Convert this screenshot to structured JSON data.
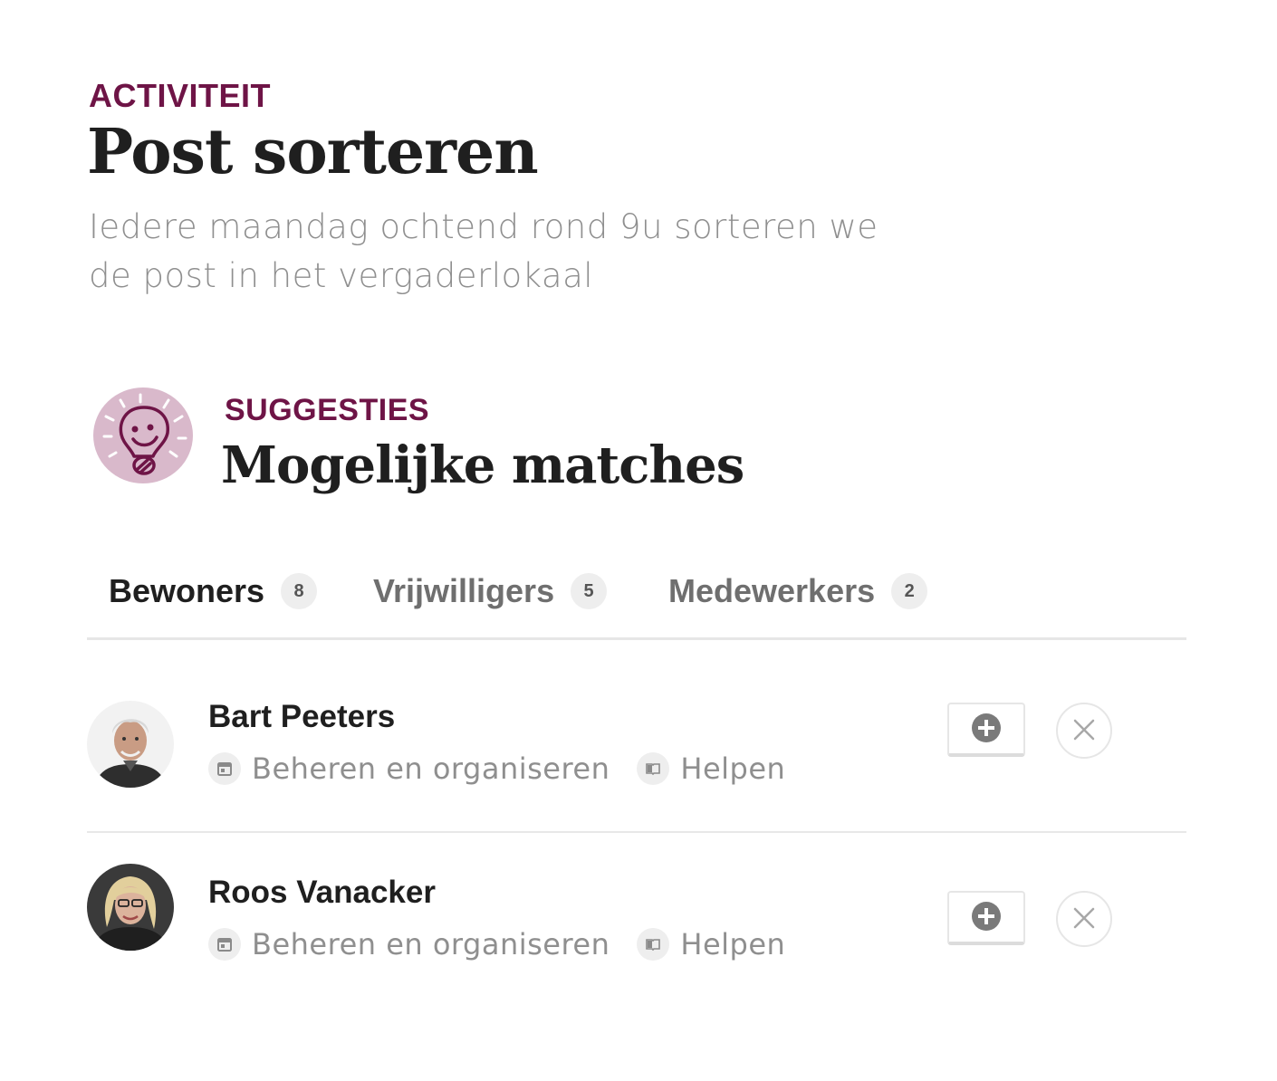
{
  "activity": {
    "eyebrow": "ACTIVITEIT",
    "title": "Post sorteren",
    "description": "Iedere maandag ochtend rond 9u sorteren we de post in het vergaderlokaal"
  },
  "suggestions": {
    "eyebrow": "SUGGESTIES",
    "title": "Mogelijke matches",
    "icon": "lightbulb-icon"
  },
  "tabs": [
    {
      "label": "Bewoners",
      "count": "8",
      "active": true
    },
    {
      "label": "Vrijwilligers",
      "count": "5",
      "active": false
    },
    {
      "label": "Medewerkers",
      "count": "2",
      "active": false
    }
  ],
  "matches": [
    {
      "name": "Bart Peeters",
      "tags": [
        {
          "icon": "calendar-icon",
          "label": "Beheren en organiseren"
        },
        {
          "icon": "book-icon",
          "label": "Helpen"
        }
      ]
    },
    {
      "name": "Roos Vanacker",
      "tags": [
        {
          "icon": "calendar-icon",
          "label": "Beheren en organiseren"
        },
        {
          "icon": "book-icon",
          "label": "Helpen"
        }
      ]
    }
  ],
  "colors": {
    "accent": "#6e1446",
    "icon_bg": "#d9b9cb",
    "muted_text": "#8f8f8f"
  }
}
